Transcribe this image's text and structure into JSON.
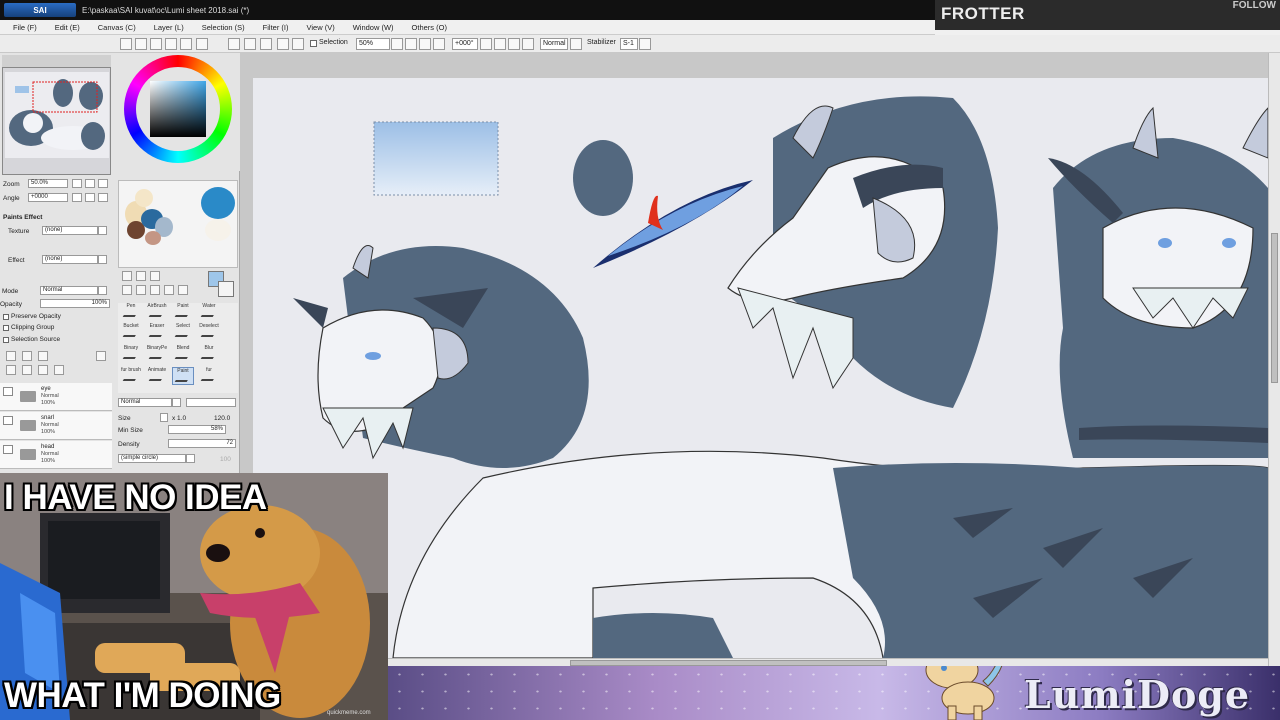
{
  "window": {
    "app_logo": "SAI",
    "title": "E:\\paskaa\\SAI kuvat\\oc\\Lumi sheet 2018.sai (*)"
  },
  "stream": {
    "name": "FROTTER",
    "follow_label": "FOLLOW",
    "brand": "LumiDoge"
  },
  "menu": [
    "File (F)",
    "Edit (E)",
    "Canvas (C)",
    "Layer (L)",
    "Selection (S)",
    "Filter (I)",
    "View (V)",
    "Window (W)",
    "Others (O)"
  ],
  "toolbar": {
    "selection_label": "Selection",
    "zoom": "50%",
    "rotation": "+000°",
    "blend": "Normal",
    "stabilizer_label": "Stabilizer",
    "stabilizer_value": "S-1"
  },
  "navigator": {
    "zoom_label": "Zoom",
    "zoom_value": "50.0%",
    "angle_label": "Angle",
    "angle_value": "+0000"
  },
  "paper": {
    "section": "Paints Effect",
    "texture_label": "Texture",
    "texture_value": "(none)",
    "effect_label": "Effect",
    "effect_value": "(none)",
    "mode_label": "Mode",
    "mode_value": "Normal",
    "opacity_label": "Opacity",
    "opacity_value": "100%",
    "preserve_opacity": "Preserve Opacity",
    "clipping_group": "Clipping Group",
    "selection_source": "Selection Source"
  },
  "layers": [
    {
      "name": "eye",
      "mode": "Normal",
      "opacity": "100%"
    },
    {
      "name": "snarl",
      "mode": "Normal",
      "opacity": "100%"
    },
    {
      "name": "head",
      "mode": "Normal",
      "opacity": "100%"
    }
  ],
  "tools": [
    "Pen",
    "AirBrush",
    "Paint",
    "Water",
    "Bucket",
    "Eraser",
    "Select",
    "Deselect",
    "Binary",
    "BinaryPe",
    "Blend",
    "Blur",
    "fur brush",
    "Animate",
    "Paint",
    "fur"
  ],
  "brush": {
    "mode": "Normal",
    "size_label": "Size",
    "size_mult": "x 1.0",
    "size_value": "120.0",
    "min_size_label": "Min Size",
    "min_size_value": "58%",
    "density_label": "Density",
    "density_value": "72",
    "shape": "(simple circle)",
    "shape_value": "100"
  },
  "meme": {
    "top": "I HAVE NO IDEA",
    "bottom": "WHAT I'M DOING",
    "credit": "quickmeme.com"
  },
  "colors": {
    "fur_dark": "#53687f",
    "fur_mid": "#7a8fa8",
    "fur_light": "#c4cbdc",
    "white_fur": "#f2f3f7",
    "eye_blue": "#6f9fe0",
    "eye_red": "#e0301c",
    "paper": "#e9eaef"
  }
}
